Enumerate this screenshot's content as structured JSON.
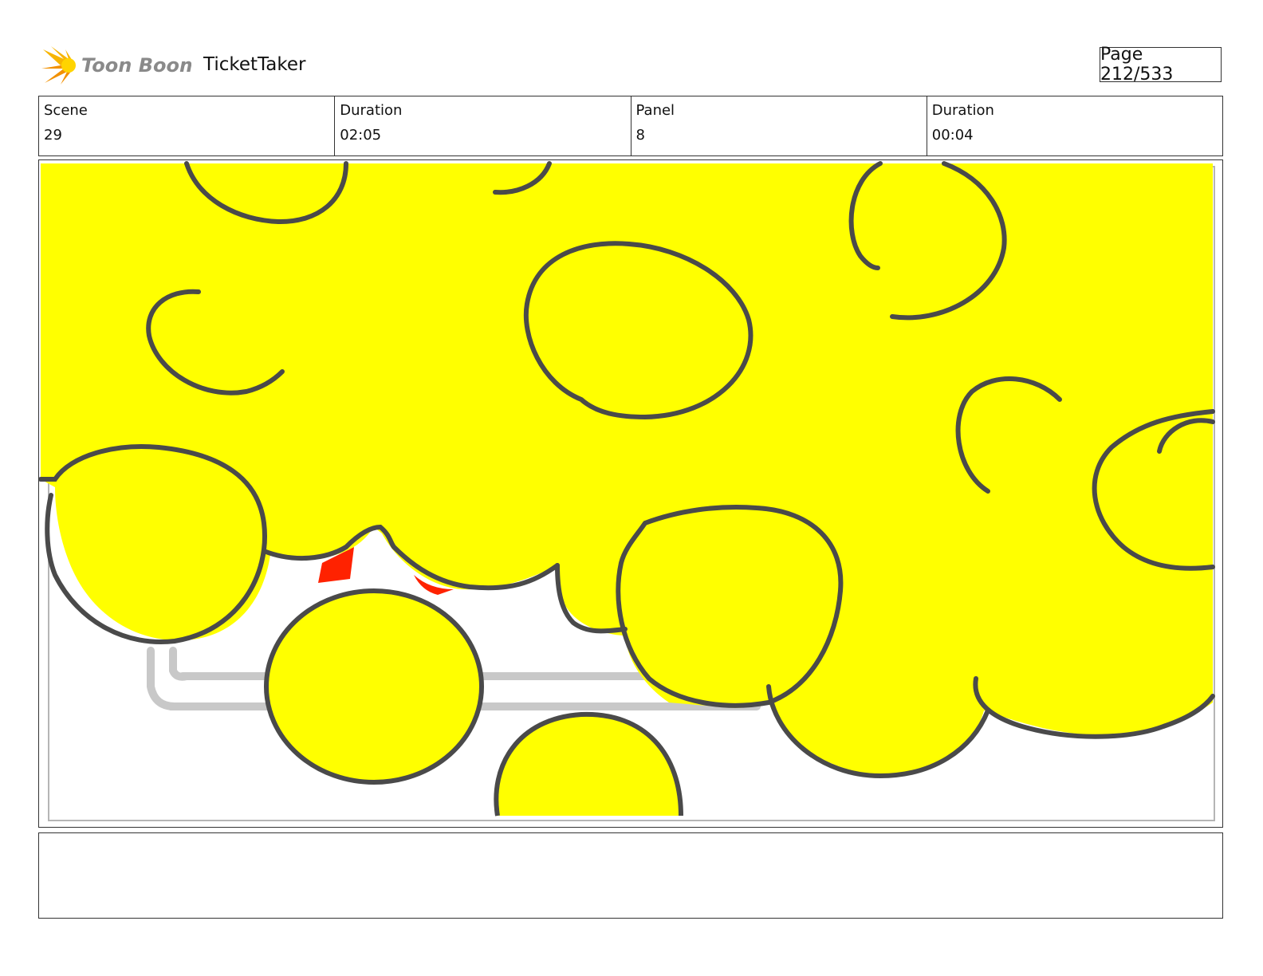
{
  "header": {
    "logo_text": "Toon Boom",
    "project_title": "TicketTaker",
    "page_label": "Page 212/533"
  },
  "info": [
    {
      "label": "Scene",
      "value": "29"
    },
    {
      "label": "Duration",
      "value": "02:05"
    },
    {
      "label": "Panel",
      "value": "8"
    },
    {
      "label": "Duration",
      "value": "00:04"
    }
  ],
  "colors": {
    "cloud_fill": "#ffff00",
    "outline": "#4a4a4a",
    "accent_red": "#ff2200",
    "sketch_gray": "#c8c8c8"
  },
  "notes": ""
}
